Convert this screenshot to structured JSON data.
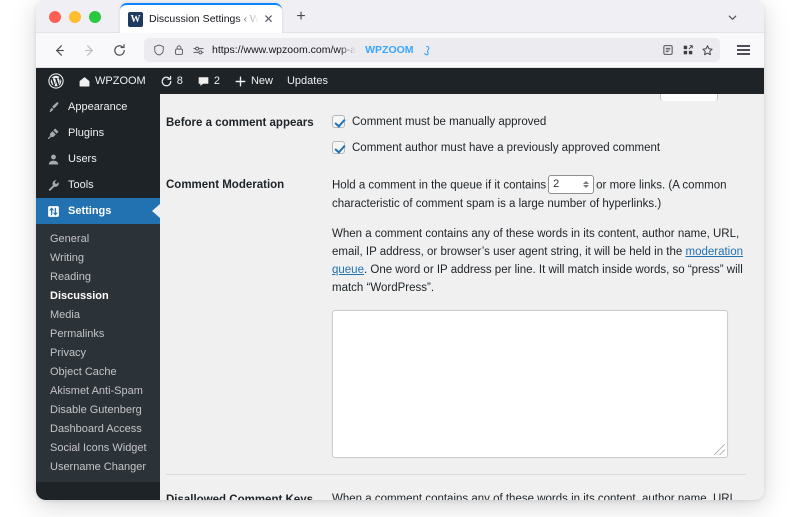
{
  "browser": {
    "tab": {
      "favicon_letter": "W",
      "title": "Discussion Settings ‹ WPZOOM",
      "close_label": "✕"
    },
    "new_tab_label": "+",
    "toolbar": {
      "back_label": "←",
      "forward_label": "→",
      "reload_label": "⟳",
      "url_text": "https://www.wpzoom.com/wp-a",
      "url_brand": "WPZOOM"
    }
  },
  "adminbar": {
    "items": [
      {
        "label": "",
        "icon": "wordpress-logo-icon"
      },
      {
        "label": "WPZOOM",
        "icon": "home-icon"
      },
      {
        "label": "8",
        "icon": "updates-icon"
      },
      {
        "label": "2",
        "icon": "comment-bubble-icon"
      },
      {
        "label": "New",
        "icon": "plus-icon"
      },
      {
        "label": "Updates",
        "icon": ""
      }
    ]
  },
  "sidebar": {
    "top_items": [
      {
        "label": "Appearance",
        "icon": "paintbrush-icon",
        "current": false
      },
      {
        "label": "Plugins",
        "icon": "plug-icon",
        "current": false
      },
      {
        "label": "Users",
        "icon": "user-icon",
        "current": false
      },
      {
        "label": "Tools",
        "icon": "wrench-icon",
        "current": false
      },
      {
        "label": "Settings",
        "icon": "sliders-icon",
        "current": true
      }
    ],
    "submenu": [
      {
        "label": "General",
        "current": false
      },
      {
        "label": "Writing",
        "current": false
      },
      {
        "label": "Reading",
        "current": false
      },
      {
        "label": "Discussion",
        "current": true
      },
      {
        "label": "Media",
        "current": false
      },
      {
        "label": "Permalinks",
        "current": false
      },
      {
        "label": "Privacy",
        "current": false
      },
      {
        "label": "Object Cache",
        "current": false
      },
      {
        "label": "Akismet Anti-Spam",
        "current": false
      },
      {
        "label": "Disable Gutenberg",
        "current": false
      },
      {
        "label": "Dashboard Access",
        "current": false
      },
      {
        "label": "Social Icons Widget",
        "current": false
      },
      {
        "label": "Username Changer",
        "current": false
      }
    ]
  },
  "main": {
    "before_comment": {
      "label": "Before a comment appears",
      "checkbox_1": {
        "label": "Comment must be manually approved",
        "checked": true
      },
      "checkbox_2": {
        "label": "Comment author must have a previously approved comment",
        "checked": true
      }
    },
    "comment_moderation": {
      "label": "Comment Moderation",
      "text_before_input": "Hold a comment in the queue if it contains",
      "links_value": "2",
      "text_after_input": "or more links. (A common",
      "text_line2": "characteristic of comment spam is a large number of hyperlinks.)",
      "para2_part1": "When a comment contains any of these words in its content, author name, URL, email, IP address, or browser’s user agent string, it will be held in the",
      "para2_link": "moderation queue",
      "para2_part2": ". One word or IP address per line. It will match inside words, so “press” will match “WordPress”.",
      "textarea_value": ""
    },
    "disallowed_keys": {
      "label": "Disallowed Comment Keys",
      "text": "When a comment contains any of these words in its content, author name, URL,"
    }
  },
  "colors": {
    "wp_admin_dark": "#1d2327",
    "wp_submenu_dark": "#2c3338",
    "wp_accent_blue": "#2271b1",
    "browser_tab_accent": "#0a84ff",
    "url_brand_blue": "#3aa5ff"
  }
}
